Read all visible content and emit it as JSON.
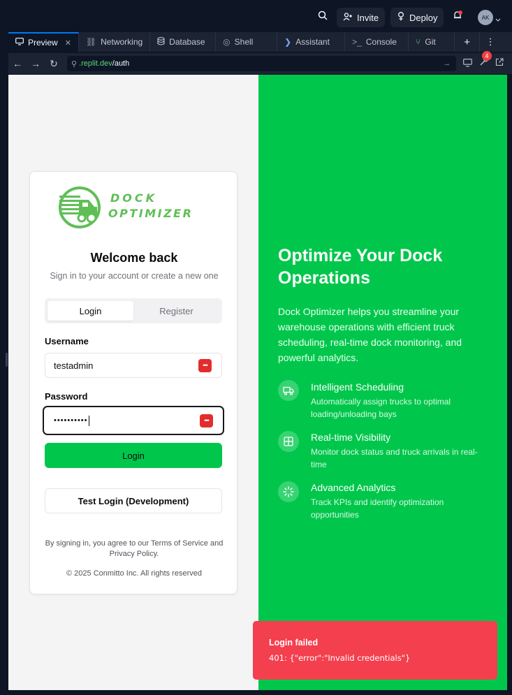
{
  "topbar": {
    "invite_label": "Invite",
    "deploy_label": "Deploy",
    "avatar_initials": "AK"
  },
  "tabs": [
    {
      "label": "Preview",
      "icon": "monitor-icon"
    },
    {
      "label": "Networking",
      "icon": "network-icon"
    },
    {
      "label": "Database",
      "icon": "database-icon"
    },
    {
      "label": "Shell",
      "icon": "shell-icon"
    },
    {
      "label": "Assistant",
      "icon": "assistant-icon"
    },
    {
      "label": "Console",
      "icon": "console-icon"
    },
    {
      "label": "Git",
      "icon": "git-icon"
    }
  ],
  "addressbar": {
    "url_prefix": ".replit.dev",
    "url_path": "/auth",
    "devtools_badge": "4"
  },
  "login": {
    "logo_line1": "DOCK",
    "logo_line2": "OPTIMIZER",
    "welcome": "Welcome back",
    "subtitle": "Sign in to your account or create a new one",
    "tab_login": "Login",
    "tab_register": "Register",
    "username_label": "Username",
    "username_value": "testadmin",
    "password_label": "Password",
    "password_value": "••••••••••",
    "login_button": "Login",
    "test_login_button": "Test Login (Development)",
    "terms": "By signing in, you agree to our Terms of Service and Privacy Policy.",
    "copyright": "© 2025 Conmitto Inc. All rights reserved"
  },
  "hero": {
    "title": "Optimize Your Dock Operations",
    "description": "Dock Optimizer helps you streamline your warehouse operations with efficient truck scheduling, real-time dock monitoring, and powerful analytics.",
    "features": [
      {
        "title": "Intelligent Scheduling",
        "desc": "Automatically assign trucks to optimal loading/unloading bays",
        "icon": "truck-icon"
      },
      {
        "title": "Real-time Visibility",
        "desc": "Monitor dock status and truck arrivals in real-time",
        "icon": "grid-icon"
      },
      {
        "title": "Advanced Analytics",
        "desc": "Track KPIs and identify optimization opportunities",
        "icon": "loader-icon"
      }
    ]
  },
  "toast": {
    "title": "Login failed",
    "message": "401: {\"error\":\"Invalid credentials\"}"
  },
  "colors": {
    "brand_green": "#00c74b",
    "toast_red": "#f43f4e",
    "ide_dark": "#0e1525"
  }
}
